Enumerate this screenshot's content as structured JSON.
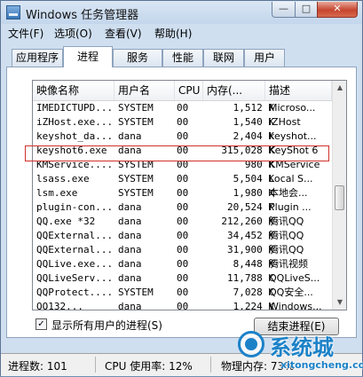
{
  "window": {
    "title": "Windows 任务管理器",
    "min_glyph": "—",
    "max_glyph": "□",
    "close_glyph": "✕"
  },
  "menu": [
    "文件(F)",
    "选项(O)",
    "查看(V)",
    "帮助(H)"
  ],
  "tabs": [
    "应用程序",
    "进程",
    "服务",
    "性能",
    "联网",
    "用户"
  ],
  "active_tab": "进程",
  "columns": [
    "映像名称",
    "用户名",
    "CPU",
    "内存(...",
    "描述"
  ],
  "processes": [
    {
      "name": "IMEDICTUPD...",
      "user": "SYSTEM",
      "cpu": "00",
      "mem": "1,512 K",
      "desc": "Microso..."
    },
    {
      "name": "iZHost.exe...",
      "user": "SYSTEM",
      "cpu": "00",
      "mem": "1,540 K",
      "desc": "iZHost"
    },
    {
      "name": "keyshot_da...",
      "user": "dana",
      "cpu": "00",
      "mem": "2,404 K",
      "desc": "keyshot..."
    },
    {
      "name": "keyshot6.exe",
      "user": "dana",
      "cpu": "00",
      "mem": "315,028 K",
      "desc": "KeyShot 6"
    },
    {
      "name": "KMService....",
      "user": "SYSTEM",
      "cpu": "00",
      "mem": "980 K",
      "desc": "KMService"
    },
    {
      "name": "lsass.exe",
      "user": "SYSTEM",
      "cpu": "00",
      "mem": "5,504 K",
      "desc": "Local S..."
    },
    {
      "name": "lsm.exe",
      "user": "SYSTEM",
      "cpu": "00",
      "mem": "1,980 K",
      "desc": "本地会..."
    },
    {
      "name": "plugin-con...",
      "user": "dana",
      "cpu": "00",
      "mem": "20,524 K",
      "desc": "Plugin ..."
    },
    {
      "name": "QQ.exe *32",
      "user": "dana",
      "cpu": "00",
      "mem": "212,260 K",
      "desc": "腾讯QQ"
    },
    {
      "name": "QQExternal...",
      "user": "dana",
      "cpu": "00",
      "mem": "34,452 K",
      "desc": "腾讯QQ"
    },
    {
      "name": "QQExternal...",
      "user": "dana",
      "cpu": "00",
      "mem": "31,900 K",
      "desc": "腾讯QQ"
    },
    {
      "name": "QQLive.exe...",
      "user": "dana",
      "cpu": "00",
      "mem": "8,448 K",
      "desc": "腾讯视频"
    },
    {
      "name": "QQLiveServ...",
      "user": "dana",
      "cpu": "00",
      "mem": "11,788 K",
      "desc": "QQLiveS..."
    },
    {
      "name": "QQProtect....",
      "user": "SYSTEM",
      "cpu": "00",
      "mem": "7,028 K",
      "desc": "QQ安全..."
    },
    {
      "name": "QQ132...",
      "user": "dana",
      "cpu": "00",
      "mem": "1,224 K",
      "desc": "Windows..."
    }
  ],
  "highlighted_process": "keyshot6.exe",
  "show_all_users": {
    "label": "显示所有用户的进程(S)",
    "checked": true
  },
  "end_process_label": "结束进程(E)",
  "status": {
    "processes": "进程数: 101",
    "cpu": "CPU 使用率: 12%",
    "memory": "物理内存: 73%"
  },
  "watermark": {
    "text": "系统城",
    "url": "xitongcheng.com"
  },
  "colors": {
    "highlight_border": "#d0302a",
    "watermark": "#1c82c8"
  }
}
